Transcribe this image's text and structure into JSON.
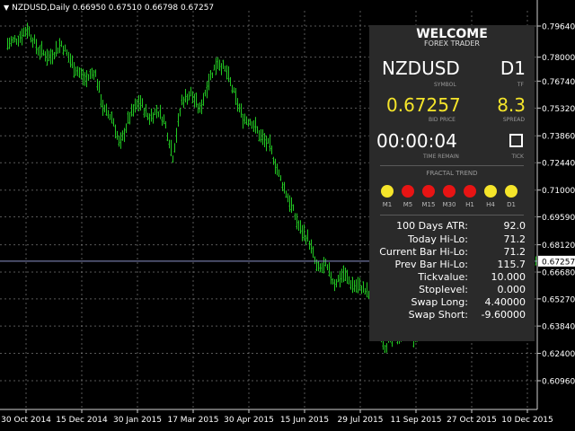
{
  "chart": {
    "header_arrow": "▼",
    "header": "NZDUSD,Daily  0.66950 0.67510 0.66798 0.67257",
    "current_price_label": "0.67257",
    "price_levels": [
      "0.79640",
      "0.78000",
      "0.76740",
      "0.75320",
      "0.73860",
      "0.72440",
      "0.71000",
      "0.69590",
      "0.68120",
      "0.66680",
      "0.65270",
      "0.63840",
      "0.62400",
      "0.60960"
    ],
    "date_labels": [
      "30 Oct 2014",
      "15 Dec 2014",
      "30 Jan 2015",
      "17 Mar 2015",
      "30 Apr 2015",
      "15 Jun 2015",
      "29 Jul 2015",
      "11 Sep 2015",
      "27 Oct 2015",
      "10 Dec 2015"
    ],
    "colors": {
      "background": "#000000",
      "bars": "#22c822",
      "grid": "#a0a0a0",
      "price_line": "#8d92c8"
    }
  },
  "panel": {
    "title": "WELCOME",
    "subtitle": "FOREX TRADER",
    "symbol": "NZDUSD",
    "symbol_caption": "SYMBOL",
    "tf": "D1",
    "tf_caption": "TF",
    "bid": "0.67257",
    "bid_caption": "BID PRICE",
    "spread": "8.3",
    "spread_caption": "SPREAD",
    "time": "00:00:04",
    "time_caption": "TIME REMAIN",
    "tick_caption": "TICK",
    "tick_checked": false,
    "fractal_title": "FRACTAL TREND",
    "fractal": [
      {
        "tf": "M1",
        "color": "#f5e52a"
      },
      {
        "tf": "M5",
        "color": "#e81414"
      },
      {
        "tf": "M15",
        "color": "#e81414"
      },
      {
        "tf": "M30",
        "color": "#e81414"
      },
      {
        "tf": "H1",
        "color": "#e81414"
      },
      {
        "tf": "H4",
        "color": "#f5e52a"
      },
      {
        "tf": "D1",
        "color": "#f5e52a"
      }
    ],
    "stats": [
      {
        "label": "100 Days ATR:",
        "value": "92.0"
      },
      {
        "label": "Today Hi-Lo:",
        "value": "71.2"
      },
      {
        "label": "Current Bar Hi-Lo:",
        "value": "71.2"
      },
      {
        "label": "Prev Bar Hi-Lo:",
        "value": "115.7"
      },
      {
        "label": "Tickvalue:",
        "value": "10.000"
      },
      {
        "label": "Stoplevel:",
        "value": "0.000"
      },
      {
        "label": "Swap Long:",
        "value": "4.40000"
      },
      {
        "label": "Swap Short:",
        "value": "-9.60000"
      }
    ]
  }
}
